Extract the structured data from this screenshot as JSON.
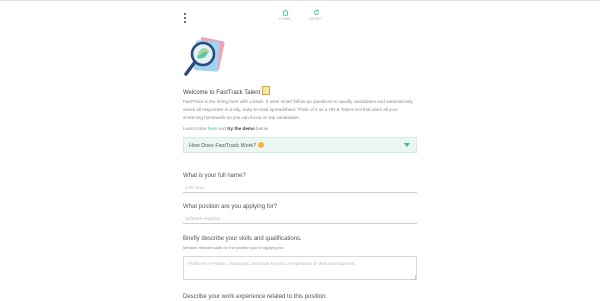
{
  "nav": {
    "home_label": "HOME",
    "reset_label": "RESET"
  },
  "icons": {
    "menu": "kebab-menu-icon",
    "home": "home-icon",
    "reset": "reset-icon",
    "logo": "magnifying-glass-logo",
    "note": "note-emoji-icon",
    "smile": "smile-emoji-icon",
    "caret": "chevron-down-icon"
  },
  "colors": {
    "accent": "#2dbe9c",
    "accordion_bg": "#ecf7f3"
  },
  "intro": {
    "title": "Welcome to FastTrack Talent",
    "description": "FastTrack is the hiring form with a brain. It uses smart follow-up questions to qualify candidates and automatically saves all responses in a tidy, easy-to-read spreadsheet. Think of it as a HR & Talent tool that does all your screening homework so you can focus on top candidates.",
    "learn_prefix": "Learn more ",
    "learn_link": "here",
    "learn_mid": " and ",
    "learn_bold": "try the demo",
    "learn_suffix": " below"
  },
  "accordion": {
    "label": "How Does FastTrack Work?"
  },
  "form": {
    "name_label": "What is your full name?",
    "name_placeholder": "John Doe",
    "position_label": "What position are you applying for?",
    "position_placeholder": "Software engineer",
    "skills_label": "Briefly describe your skills and qualifications.",
    "skills_hint": "Mention relevant skills for the position you're applying for.",
    "skills_placeholder": "Proficient in Python, JavaScript, and have 5 years of experience in Web Development.",
    "experience_label": "Describe your work experience related to this position."
  }
}
